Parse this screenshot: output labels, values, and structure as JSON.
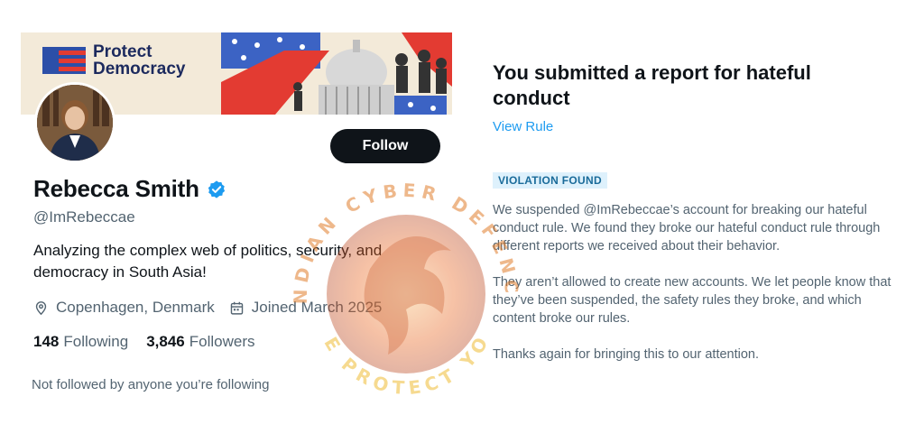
{
  "banner": {
    "logo_line1": "Protect",
    "logo_line2": "Democracy"
  },
  "profile": {
    "follow_label": "Follow",
    "display_name": "Rebecca Smith",
    "handle": "@ImRebeccae",
    "bio": "Analyzing the complex web of politics, security, and democracy in South Asia!",
    "location": "Copenhagen, Denmark",
    "joined": "Joined March 2025",
    "following_count": "148",
    "following_label": "Following",
    "followers_count": "3,846",
    "followers_label": "Followers",
    "not_followed_text": "Not followed by anyone you’re following"
  },
  "report": {
    "title": "You submitted a report for hateful conduct",
    "view_rule_label": "View Rule",
    "badge": "VIOLATION FOUND",
    "paragraph1": "We suspended @ImRebeccae’s account for breaking our hateful conduct rule. We found they broke our hateful conduct rule through different reports we received about their behavior.",
    "paragraph2": "They aren’t allowed to create new accounts. We let people know that they’ve been suspended, the safety rules they broke, and which content broke our rules.",
    "paragraph3": "Thanks again for bringing this to our attention."
  },
  "watermark": {
    "text_top": "INDIAN CYBER DEFENCE",
    "text_bottom": "WE PROTECT YOU"
  },
  "colors": {
    "primary_text": "#0f1419",
    "secondary_text": "#536471",
    "link_blue": "#1d9bf0",
    "verified_blue": "#1d9bf0",
    "badge_bg": "#def1fc",
    "logo_red": "#e33b32",
    "logo_blue": "#2c4fa8",
    "watermark_orange": "#e8641e"
  },
  "icons": {
    "verified": "verified-badge-icon",
    "location": "location-pin-icon",
    "calendar": "calendar-icon"
  }
}
